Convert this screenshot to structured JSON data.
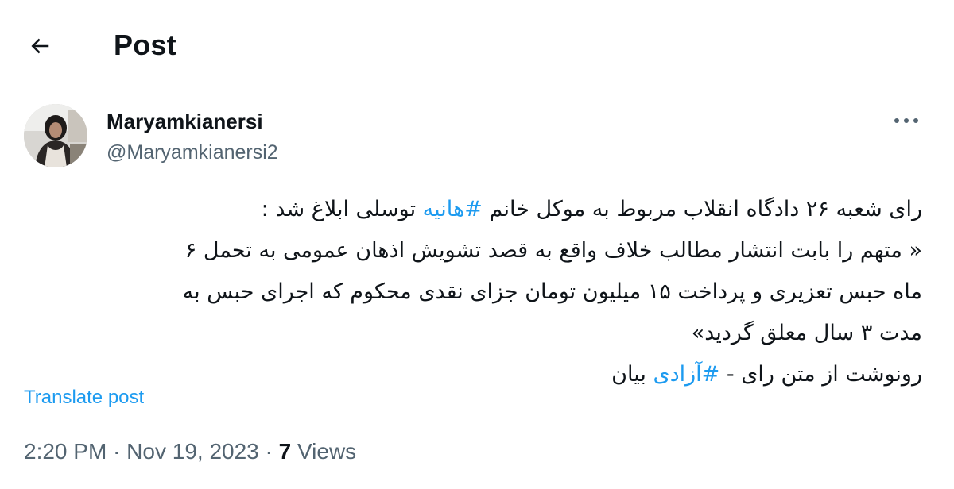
{
  "header": {
    "title": "Post",
    "back_icon": "arrow-left-icon"
  },
  "author": {
    "display_name": "Maryamkianersi",
    "handle": "@Maryamkianersi2",
    "avatar_icon": "avatar-photo"
  },
  "tweet": {
    "line1_before": "رای شعبه ۲۶ دادگاه انقلاب مربوط به موکل خانم ",
    "line1_hashtag": "#هانیه",
    "line1_after": " توسلی ابلاغ شد :",
    "line2": "« متهم را بابت انتشار مطالب خلاف واقع به قصد تشویش اذهان عمومی به تحمل ۶",
    "line3": "ماه حبس  تعزیری و پرداخت  ۱۵ میلیون تومان جزای نقدی محکوم که اجرای حبس به",
    "line4": "مدت ۳ سال معلق گردید»",
    "line5_before": "رونوشت از متن رای - ",
    "line5_hashtag": "#آزادی",
    "line5_after": " بیان"
  },
  "translate_label": "Translate post",
  "meta": {
    "time": "2:20 PM",
    "separator": " · ",
    "date": "Nov 19, 2023",
    "views_count": "7",
    "views_label": " Views"
  },
  "colors": {
    "accent": "#1d9bf0",
    "text_primary": "#0f1419",
    "text_secondary": "#536471"
  },
  "more_icon": "more-dots-icon"
}
